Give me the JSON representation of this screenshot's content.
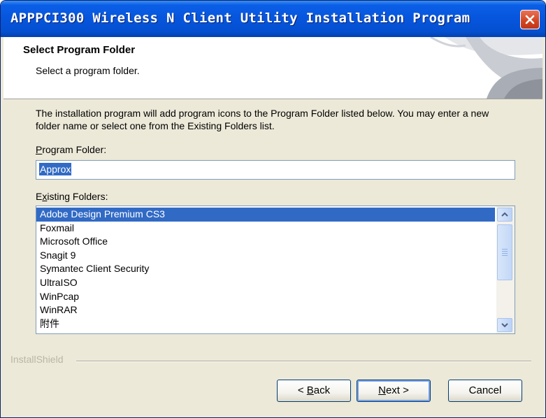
{
  "window": {
    "title": "APPPCI300 Wireless N Client Utility Installation Program"
  },
  "header": {
    "title": "Select Program Folder",
    "subtitle": "Select a program folder."
  },
  "description": "The installation program will add program icons to the Program Folder listed below. You may enter a new folder name or select one from the Existing Folders list.",
  "program_folder": {
    "label_mnemonic": "P",
    "label_rest": "rogram Folder:",
    "value": "Approx"
  },
  "existing_folders": {
    "label_before": "E",
    "label_mnemonic": "x",
    "label_rest": "isting Folders:",
    "items": [
      "Adobe Design Premium CS3",
      "Foxmail",
      "Microsoft Office",
      "Snagit 9",
      "Symantec Client Security",
      "UltraISO",
      "WinPcap",
      "WinRAR",
      "附件"
    ],
    "selected_index": 0
  },
  "branding": "InstallShield",
  "buttons": {
    "back": {
      "prefix": "< ",
      "mnemonic": "B",
      "rest": "ack"
    },
    "next": {
      "mnemonic": "N",
      "rest": "ext >"
    },
    "cancel": "Cancel"
  },
  "colors": {
    "selection": "#316ac5",
    "titlebar": "#0655dc",
    "dialog_background": "#ece9d8"
  },
  "icons": [
    "close-icon",
    "scroll-up-icon",
    "scroll-down-icon",
    "header-graphic"
  ]
}
